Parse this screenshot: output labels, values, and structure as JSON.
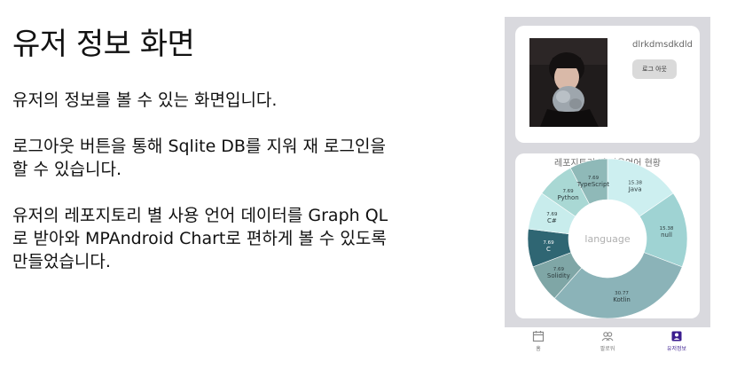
{
  "slide": {
    "title": "유저 정보 화면",
    "paragraphs": [
      "유저의 정보를 볼 수 있는 화면입니다.",
      "로그아웃 버튼을 통해 Sqlite DB를 지워 재 로그인을\n할 수 있습니다.",
      "유저의 레포지토리 별 사용 언어 데이터를 Graph QL\n로 받아와 MPAndroid Chart로 편하게 볼 수 있도록\n만들었습니다."
    ]
  },
  "profile": {
    "username": "dlrkdmsdkdld",
    "logout_label": "로그 아웃",
    "avatar": "user-photo"
  },
  "chart_data": {
    "type": "pie",
    "title": "레포지토리 별 사용언어 현황",
    "center_text": "language",
    "slices": [
      {
        "label": "Java",
        "value": 15.38,
        "value_text": "15.38",
        "color": "#cdeff0"
      },
      {
        "label": "null",
        "value": 15.38,
        "value_text": "15.38",
        "color": "#9fd3d3"
      },
      {
        "label": "Kotlin",
        "value": 30.77,
        "value_text": "30.77",
        "color": "#8bb3b8"
      },
      {
        "label": "Solidity",
        "value": 7.69,
        "value_text": "7.69",
        "color": "#7fa6a6"
      },
      {
        "label": "C",
        "value": 7.69,
        "value_text": "7.69",
        "color": "#2f6673"
      },
      {
        "label": "C#",
        "value": 7.69,
        "value_text": "7.69",
        "color": "#c8ecec"
      },
      {
        "label": "Python",
        "value": 7.69,
        "value_text": "7.69",
        "color": "#a9d8d4"
      },
      {
        "label": "TypeScript",
        "value": 7.69,
        "value_text": "7.69",
        "color": "#8fb9b8"
      }
    ]
  },
  "nav": {
    "items": [
      {
        "label": "홈",
        "icon": "calendar-icon"
      },
      {
        "label": "팔로워",
        "icon": "people-icon"
      },
      {
        "label": "유저정보",
        "icon": "user-icon"
      }
    ]
  },
  "colors": {
    "phone_background": "#d9d9de",
    "active_nav": "#3b1d8f"
  }
}
